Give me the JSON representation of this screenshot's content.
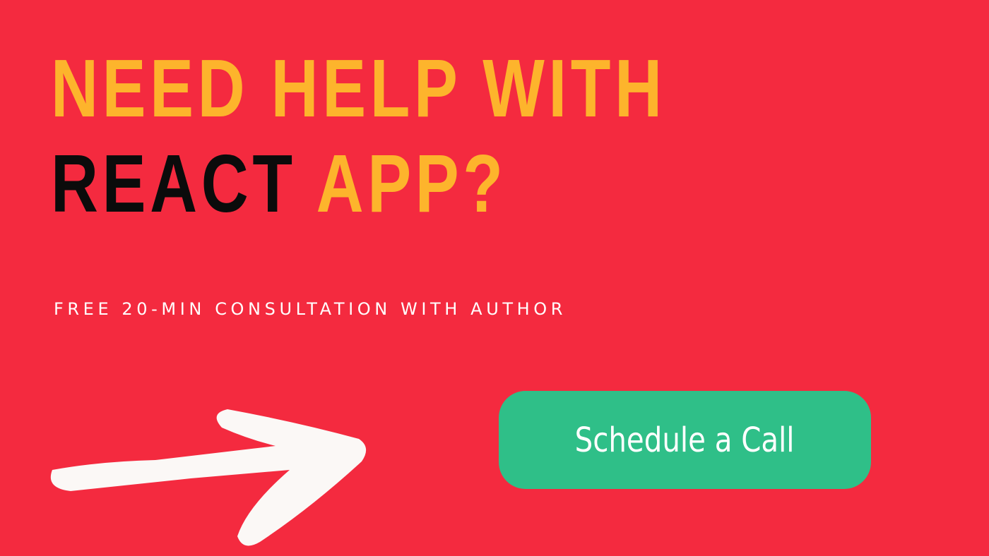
{
  "banner": {
    "headline": {
      "line1": "NEED HELP WITH",
      "line2_dark": "REACT",
      "line2_accent": "APP?"
    },
    "subheading": "FREE 20-MIN CONSULTATION WITH AUTHOR",
    "cta_label": "Schedule a Call",
    "decoration": "arrow-right-icon"
  },
  "colors": {
    "background": "#f42a3f",
    "headline_accent": "#fdb42c",
    "headline_dark": "#0b0b0b",
    "button": "#2fbf88",
    "text_light": "#ffffff",
    "arrow": "#fbf8f6"
  }
}
